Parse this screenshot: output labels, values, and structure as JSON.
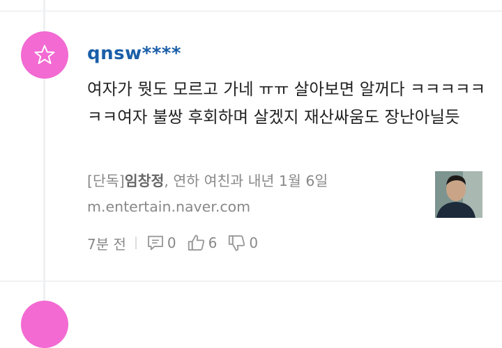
{
  "comment": {
    "username": "qnsw****",
    "text": "여자가 뭣도 모르고 가네 ㅠㅠ 살아보면 알꺼다 ㅋㅋㅋㅋㅋㅋㅋ여자 불쌍 후회하며 살겠지 재산싸움도 장난아닐듯",
    "link": {
      "title_prefix": "[단독]",
      "title_bold": "임창정",
      "title_rest": ", 연하 여친과 내년 1월 6일",
      "url": "m.entertain.naver.com"
    },
    "time": "7분 전",
    "replies": "0",
    "likes": "6",
    "dislikes": "0",
    "icons": {
      "avatar": "star-icon",
      "reply": "reply-icon",
      "like": "thumbs-up-icon",
      "dislike": "thumbs-down-icon"
    }
  },
  "colors": {
    "avatar_bg": "#f26ad2",
    "username": "#1a5ea8",
    "body_text": "#222222",
    "meta_text": "#888888"
  }
}
